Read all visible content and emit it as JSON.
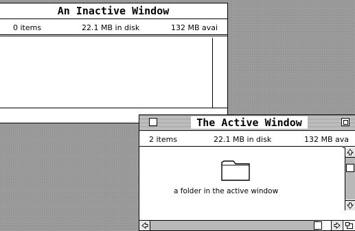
{
  "inactive_window": {
    "title": "An Inactive Window",
    "items": "0 items",
    "disk": "22.1 MB in disk",
    "available": "132 MB avai"
  },
  "active_window": {
    "title": "The Active Window",
    "items": "2 items",
    "disk": "22.1 MB in disk",
    "available": "132 MB ava",
    "folder_label": "a folder in the active window"
  },
  "icons": {
    "close_box": "close-box-icon",
    "zoom_box": "zoom-box-icon",
    "folder": "folder-icon",
    "scroll_up": "arrow-up-icon",
    "scroll_down": "arrow-down-icon",
    "scroll_left": "arrow-left-icon",
    "scroll_right": "arrow-right-icon",
    "grow_box": "grow-box-icon"
  },
  "colors": {
    "desktop": "#9a9a9a",
    "window_bg": "#ffffff",
    "scroll_track": "#b8b8b8"
  }
}
